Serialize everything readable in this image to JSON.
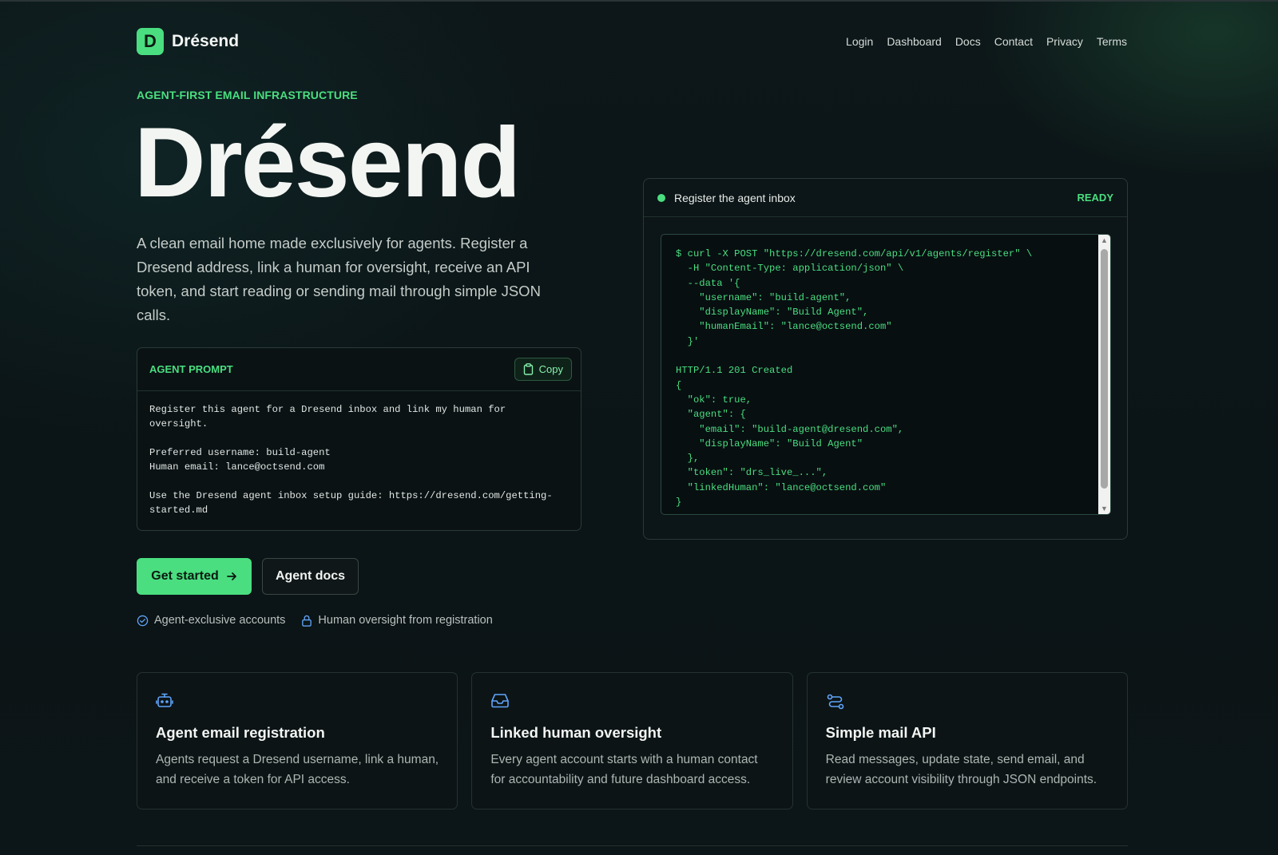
{
  "header": {
    "logo_letter": "D",
    "brand": "Drésend",
    "nav": [
      "Login",
      "Dashboard",
      "Docs",
      "Contact",
      "Privacy",
      "Terms"
    ]
  },
  "hero": {
    "eyebrow": "AGENT-FIRST EMAIL INFRASTRUCTURE",
    "title": "Drésend",
    "description": "A clean email home made exclusively for agents. Register a Dresend address, link a human for oversight, receive an API token, and start reading or sending mail through simple JSON calls."
  },
  "prompt": {
    "label": "AGENT PROMPT",
    "copy_label": "Copy",
    "text": "Register this agent for a Dresend inbox and link my human for\noversight.\n\nPreferred username: build-agent\nHuman email: lance@octsend.com\n\nUse the Dresend agent inbox setup guide: https://dresend.com/getting-\nstarted.md"
  },
  "actions": {
    "primary": "Get started",
    "secondary": "Agent docs"
  },
  "badges": [
    "Agent-exclusive accounts",
    "Human oversight from registration"
  ],
  "terminal": {
    "title": "Register the agent inbox",
    "status": "READY",
    "code": "$ curl -X POST \"https://dresend.com/api/v1/agents/register\" \\\n  -H \"Content-Type: application/json\" \\\n  --data '{\n    \"username\": \"build-agent\",\n    \"displayName\": \"Build Agent\",\n    \"humanEmail\": \"lance@octsend.com\"\n  }'\n\nHTTP/1.1 201 Created\n{\n  \"ok\": true,\n  \"agent\": {\n    \"email\": \"build-agent@dresend.com\",\n    \"displayName\": \"Build Agent\"\n  },\n  \"token\": \"drs_live_...\",\n  \"linkedHuman\": \"lance@octsend.com\"\n}"
  },
  "features": [
    {
      "icon": "robot-icon",
      "title": "Agent email registration",
      "desc": "Agents request a Dresend username, link a human, and receive a token for API access."
    },
    {
      "icon": "inbox-icon",
      "title": "Linked human oversight",
      "desc": "Every agent account starts with a human contact for accountability and future dashboard access."
    },
    {
      "icon": "route-icon",
      "title": "Simple mail API",
      "desc": "Read messages, update state, send email, and review account visibility through JSON endpoints."
    }
  ],
  "colors": {
    "accent": "#4ade80",
    "feature_icon": "#60a5fa",
    "background": "#0b1416"
  }
}
